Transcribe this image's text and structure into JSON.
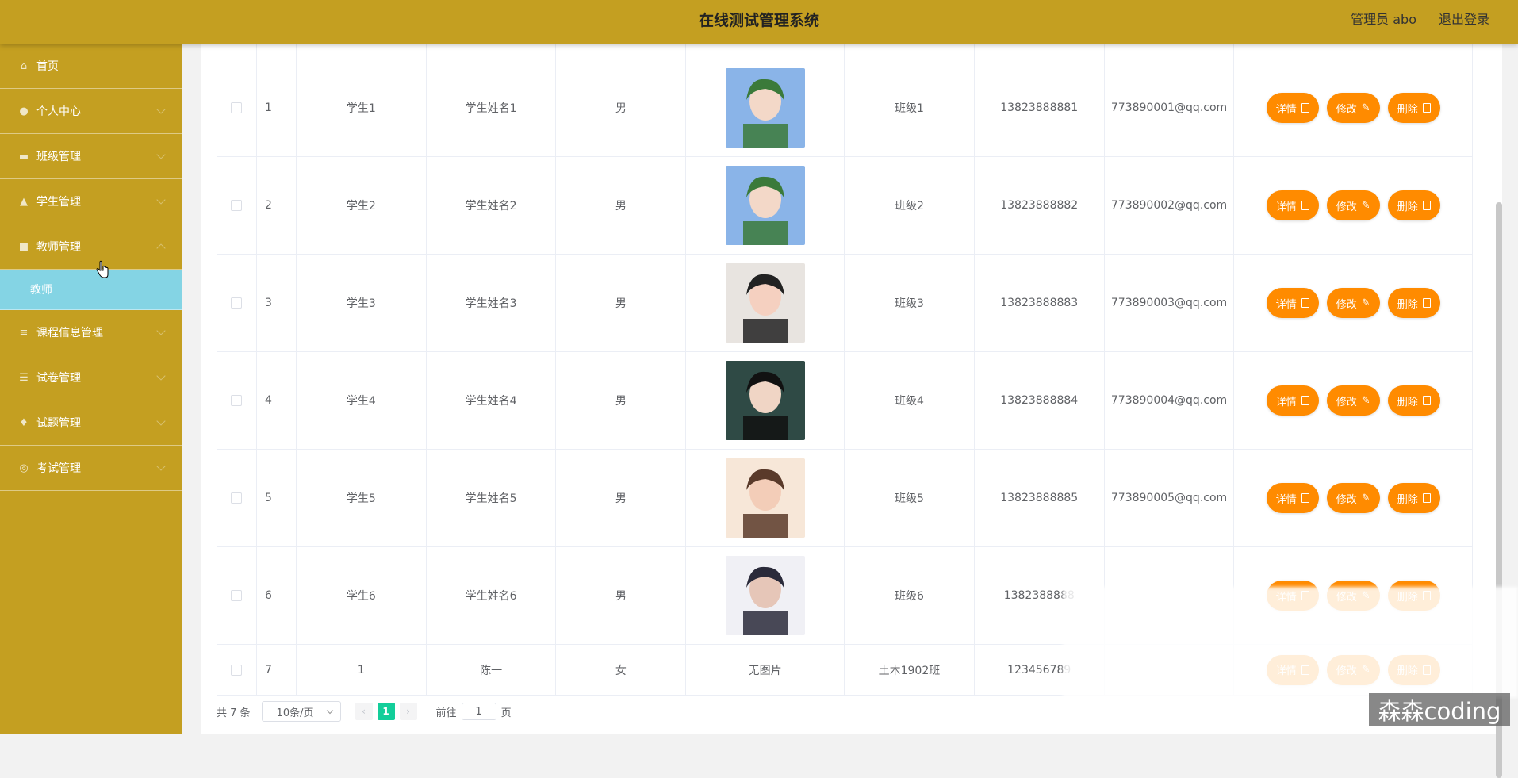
{
  "header": {
    "title": "在线测试管理系统",
    "user": "管理员 abo",
    "logout": "退出登录"
  },
  "sidebar": {
    "items": [
      {
        "label": "首页",
        "icon": "home-icon"
      },
      {
        "label": "个人中心",
        "icon": "user-icon"
      },
      {
        "label": "班级管理",
        "icon": "class-icon"
      },
      {
        "label": "学生管理",
        "icon": "student-icon"
      },
      {
        "label": "教师管理",
        "icon": "teacher-icon",
        "sub": "教师"
      },
      {
        "label": "课程信息管理",
        "icon": "course-icon"
      },
      {
        "label": "试卷管理",
        "icon": "paper-icon"
      },
      {
        "label": "试题管理",
        "icon": "question-icon"
      },
      {
        "label": "考试管理",
        "icon": "exam-icon"
      }
    ]
  },
  "table": {
    "rows": [
      {
        "idx": "1",
        "account": "学生1",
        "name": "学生姓名1",
        "sex": "男",
        "photo": "photo",
        "cls": "班级1",
        "phone": "13823888881",
        "email": "773890001@qq.com"
      },
      {
        "idx": "2",
        "account": "学生2",
        "name": "学生姓名2",
        "sex": "男",
        "photo": "photo",
        "cls": "班级2",
        "phone": "13823888882",
        "email": "773890002@qq.com"
      },
      {
        "idx": "3",
        "account": "学生3",
        "name": "学生姓名3",
        "sex": "男",
        "photo": "photo",
        "cls": "班级3",
        "phone": "13823888883",
        "email": "773890003@qq.com"
      },
      {
        "idx": "4",
        "account": "学生4",
        "name": "学生姓名4",
        "sex": "男",
        "photo": "photo",
        "cls": "班级4",
        "phone": "13823888884",
        "email": "773890004@qq.com"
      },
      {
        "idx": "5",
        "account": "学生5",
        "name": "学生姓名5",
        "sex": "男",
        "photo": "photo",
        "cls": "班级5",
        "phone": "13823888885",
        "email": "773890005@qq.com"
      },
      {
        "idx": "6",
        "account": "学生6",
        "name": "学生姓名6",
        "sex": "男",
        "photo": "photo",
        "cls": "班级6",
        "phone": "1382388888",
        "email": ""
      },
      {
        "idx": "7",
        "account": "1",
        "name": "陈一",
        "sex": "女",
        "photo": "无图片",
        "cls": "土木1902班",
        "phone": "123456789",
        "email": ""
      }
    ],
    "actions": {
      "detail": "详情",
      "edit": "修改",
      "delete": "删除"
    }
  },
  "pager": {
    "total": "共 7 条",
    "size": "10条/页",
    "current": "1",
    "goto_prefix": "前往",
    "goto_value": "1",
    "goto_suffix": "页"
  },
  "watermark": "森森coding",
  "colors": {
    "topbar": "#c49f21",
    "sidebar": "#c49f21",
    "submenu": "#84d4e4",
    "button": "#ff8b00",
    "page_active": "#13ce9a"
  }
}
